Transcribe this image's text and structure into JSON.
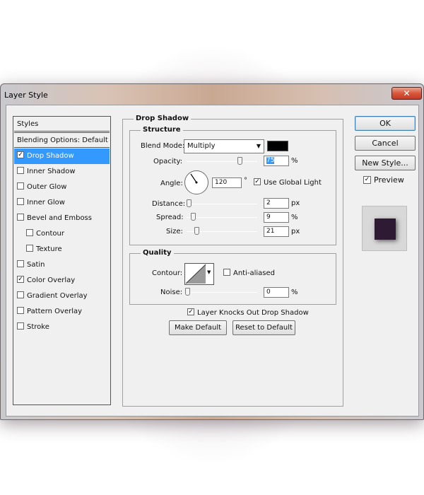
{
  "window": {
    "title": "Layer Style",
    "close_glyph": "✕"
  },
  "styles_panel": {
    "header": "Styles",
    "blending_options": "Blending Options: Default",
    "items": [
      {
        "label": "Drop Shadow",
        "checked": true,
        "selected": true
      },
      {
        "label": "Inner Shadow",
        "checked": false
      },
      {
        "label": "Outer Glow",
        "checked": false
      },
      {
        "label": "Inner Glow",
        "checked": false
      },
      {
        "label": "Bevel and Emboss",
        "checked": false
      },
      {
        "label": "Contour",
        "checked": false,
        "indent": true
      },
      {
        "label": "Texture",
        "checked": false,
        "indent": true
      },
      {
        "label": "Satin",
        "checked": false
      },
      {
        "label": "Color Overlay",
        "checked": true
      },
      {
        "label": "Gradient Overlay",
        "checked": false
      },
      {
        "label": "Pattern Overlay",
        "checked": false
      },
      {
        "label": "Stroke",
        "checked": false
      }
    ]
  },
  "drop_shadow": {
    "section_title": "Drop Shadow",
    "structure": {
      "title": "Structure",
      "blend_mode_label": "Blend Mode:",
      "blend_mode_value": "Multiply",
      "shadow_color": "#000000",
      "opacity_label": "Opacity:",
      "opacity_value": "75",
      "opacity_unit": "%",
      "angle_label": "Angle:",
      "angle_value": "120",
      "angle_unit": "°",
      "use_global_light_label": "Use Global Light",
      "use_global_light": true,
      "distance_label": "Distance:",
      "distance_value": "2",
      "distance_unit": "px",
      "spread_label": "Spread:",
      "spread_value": "9",
      "spread_unit": "%",
      "size_label": "Size:",
      "size_value": "21",
      "size_unit": "px"
    },
    "quality": {
      "title": "Quality",
      "contour_label": "Contour:",
      "anti_aliased_label": "Anti-aliased",
      "anti_aliased": false,
      "noise_label": "Noise:",
      "noise_value": "0",
      "noise_unit": "%"
    },
    "knocks_out_label": "Layer Knocks Out Drop Shadow",
    "knocks_out": true,
    "make_default_label": "Make Default",
    "reset_default_label": "Reset to Default"
  },
  "buttons": {
    "ok": "OK",
    "cancel": "Cancel",
    "new_style": "New Style...",
    "preview_label": "Preview",
    "preview_checked": true
  },
  "check_glyph": "✓",
  "preview_color": "#2e1a33"
}
